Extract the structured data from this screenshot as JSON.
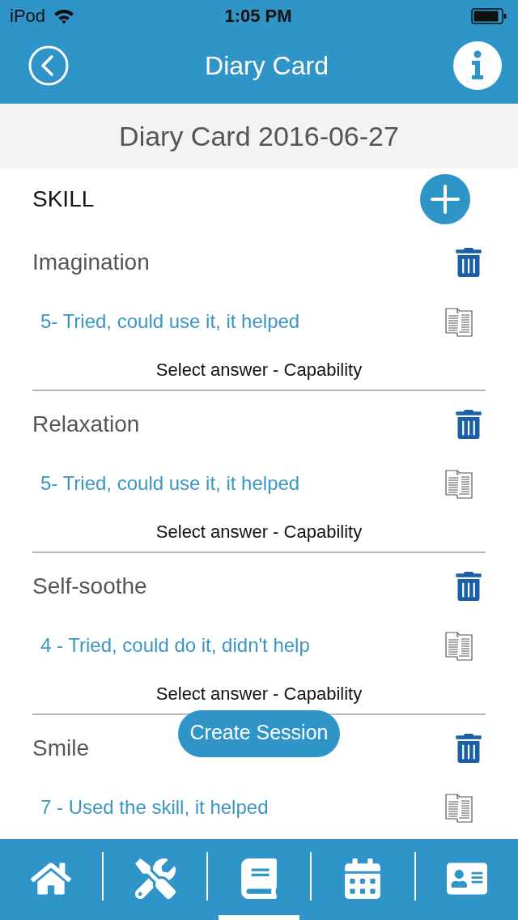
{
  "status_bar": {
    "carrier": "iPod",
    "time": "1:05 PM"
  },
  "nav_bar": {
    "title": "Diary Card"
  },
  "header": {
    "title": "Diary Card 2016-06-27"
  },
  "section": {
    "title": "SKILL"
  },
  "skills": [
    {
      "name": "Imagination",
      "answer": "5- Tried, could use it, it helped",
      "caption": "Select answer - Capability"
    },
    {
      "name": "Relaxation",
      "answer": "5- Tried, could use it, it helped",
      "caption": "Select answer - Capability"
    },
    {
      "name": "Self-soothe",
      "answer": "4 - Tried, could do it, didn't help",
      "caption": "Select answer - Capability"
    },
    {
      "name": "Smile",
      "answer": "7 - Used the skill, it helped"
    }
  ],
  "floating_button": {
    "label": "Create Session"
  },
  "tab_bar": {
    "tabs": [
      {
        "selected": false
      },
      {
        "selected": false
      },
      {
        "selected": true
      },
      {
        "selected": false
      },
      {
        "selected": false
      }
    ]
  }
}
